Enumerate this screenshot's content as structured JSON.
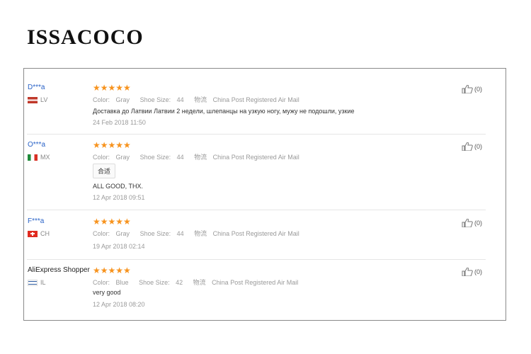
{
  "brand": "ISSACOCO",
  "labels": {
    "color": "Color:",
    "shoe_size": "Shoe Size:",
    "logistics": "物流"
  },
  "reviews": [
    {
      "user": "D***a",
      "country": "LV",
      "rating": 5,
      "stars": "★★★★★",
      "color": "Gray",
      "shoe_size": "44",
      "shipping": "China Post Registered Air Mail",
      "text": "Доставка до Латвии Латвии 2 недели, шлепанцы на узкую ногу, мужу не подошли, узкие",
      "date": "24 Feb 2018 11:50",
      "likes": "(0)"
    },
    {
      "user": "O***a",
      "country": "MX",
      "rating": 5,
      "stars": "★★★★★",
      "color": "Gray",
      "shoe_size": "44",
      "shipping": "China Post Registered Air Mail",
      "tag": "合适",
      "text": "ALL GOOD, THX.",
      "date": "12 Apr 2018 09:51",
      "likes": "(0)"
    },
    {
      "user": "F***a",
      "country": "CH",
      "rating": 5,
      "stars": "★★★★★",
      "color": "Gray",
      "shoe_size": "44",
      "shipping": "China Post Registered Air Mail",
      "date": "19 Apr 2018 02:14",
      "likes": "(0)"
    },
    {
      "user": "AliExpress Shopper",
      "country": "IL",
      "rating": 5,
      "stars": "★★★★★",
      "color": "Blue",
      "shoe_size": "42",
      "shipping": "China Post Registered Air Mail",
      "text": "very good",
      "date": "12 Apr 2018 08:20",
      "likes": "(0)"
    }
  ]
}
